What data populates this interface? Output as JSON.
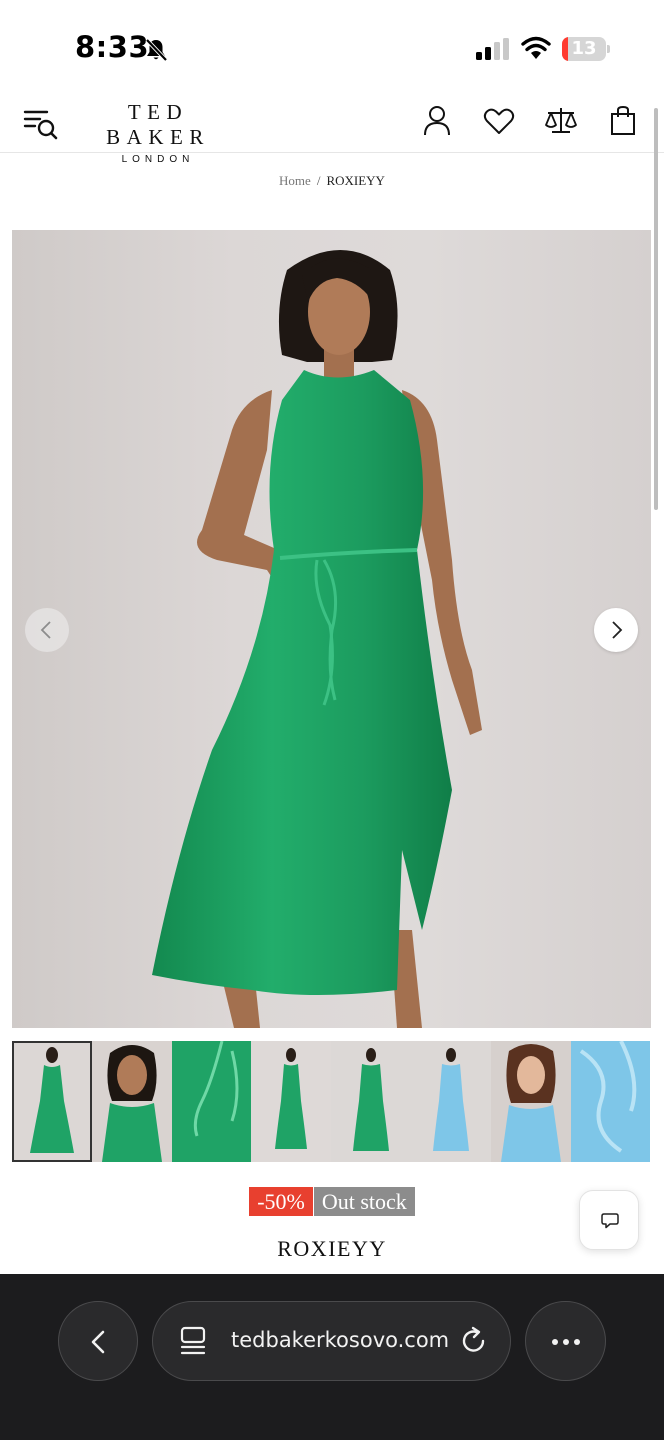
{
  "status_bar": {
    "time": "8:33",
    "battery_level": "13",
    "battery_percent": 13,
    "battery_color": "#ff3b30",
    "icons": [
      "bell-slash-icon",
      "signal-icon",
      "wifi-icon",
      "battery-icon"
    ]
  },
  "header": {
    "logo_main": "TED BAKER",
    "logo_sub": "LONDON",
    "icons": [
      "menu-search-icon",
      "account-icon",
      "heart-icon",
      "scale-icon",
      "shopping-bag-icon"
    ]
  },
  "breadcrumb": {
    "home": "Home",
    "separator": "/",
    "current": "ROXIEYY"
  },
  "gallery": {
    "image_alt": "Woman wearing green satin halter neck midi dress",
    "prev_icon": "chevron-left-icon",
    "next_icon": "chevron-right-icon",
    "thumbnail_count": 8,
    "active_thumbnail": 1
  },
  "product": {
    "discount": "-50%",
    "stock_status": "Out stock",
    "name": "ROXIEYY",
    "discount_color": "#e8402f",
    "stock_color": "#8c8c8c"
  },
  "chat": {
    "icon": "chat-bubble-icon"
  },
  "browser": {
    "url": "tedbakerkosovo.com",
    "icons": [
      "chevron-left-icon",
      "tabs-icon",
      "reload-icon",
      "more-icon"
    ]
  },
  "colors": {
    "dress_green": "#1fa366",
    "dress_blue": "#7ec6e8",
    "browser_bg": "#1c1c1e"
  }
}
